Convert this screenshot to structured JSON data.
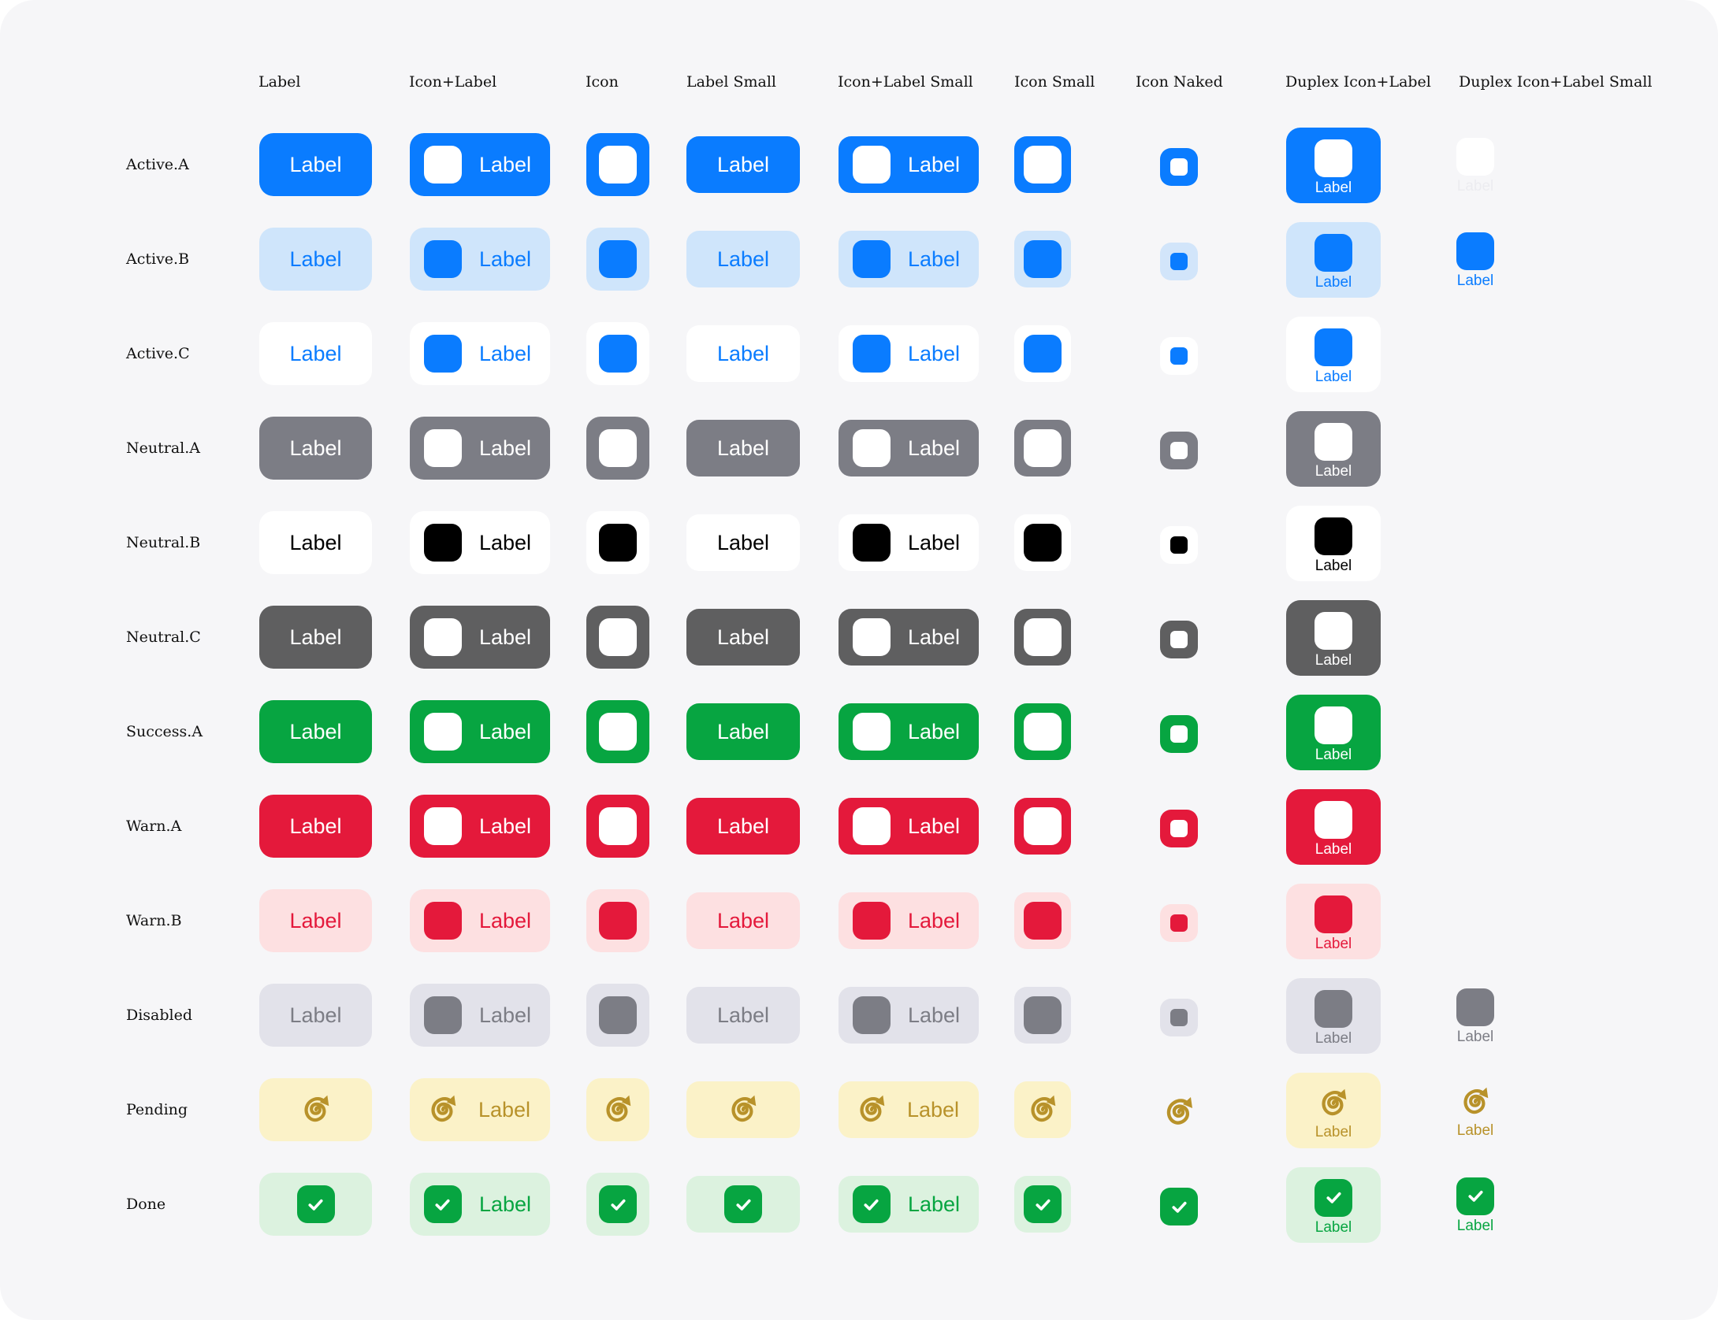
{
  "columns": [
    {
      "key": "label",
      "title": "Label"
    },
    {
      "key": "icon_label",
      "title": "Icon+Label"
    },
    {
      "key": "icon",
      "title": "Icon"
    },
    {
      "key": "label_small",
      "title": "Label Small"
    },
    {
      "key": "icon_label_small",
      "title": "Icon+Label Small"
    },
    {
      "key": "icon_small",
      "title": "Icon Small"
    },
    {
      "key": "icon_naked",
      "title": "Icon Naked"
    },
    {
      "key": "duplex",
      "title": "Duplex Icon+Label"
    },
    {
      "key": "duplex_small",
      "title": "Duplex Icon+Label Small"
    }
  ],
  "button_label": "Label",
  "rows": [
    {
      "name": "Active.A",
      "bg": "#0a7cff",
      "fg": "#ffffff",
      "icon": "#ffffff",
      "ring": "#ffffff",
      "naked_ring": "#0a7cff",
      "naked_bg": "#ffffff",
      "naked_dot": "#ffffff",
      "duplex_small": "ghost"
    },
    {
      "name": "Active.B",
      "bg": "#cfe5fb",
      "fg": "#0a7cff",
      "icon": "#0a7cff",
      "naked_bg": "#d2e5fa",
      "naked_dot": "#0a7cff",
      "duplex_small": "show"
    },
    {
      "name": "Active.C",
      "bg": "#ffffff",
      "fg": "#0a7cff",
      "icon": "#0a7cff",
      "naked_bg": "#ffffff",
      "naked_dot": "#0a7cff",
      "duplex_small": "none"
    },
    {
      "name": "Neutral.A",
      "bg": "#7c7d85",
      "fg": "#ffffff",
      "icon": "#ffffff",
      "ring": "#ffffff",
      "naked_ring": "#7c7d85",
      "naked_bg": "#ffffff",
      "naked_dot": "#ffffff",
      "duplex_small": "none"
    },
    {
      "name": "Neutral.B",
      "bg": "#ffffff",
      "fg": "#000000",
      "icon": "#000000",
      "naked_bg": "#ffffff",
      "naked_dot": "#000000",
      "duplex_small": "none"
    },
    {
      "name": "Neutral.C",
      "bg": "#5f5f60",
      "fg": "#ffffff",
      "icon": "#ffffff",
      "ring": "#ffffff",
      "naked_ring": "#5f5f60",
      "naked_bg": "#ffffff",
      "naked_dot": "#ffffff",
      "duplex_small": "none"
    },
    {
      "name": "Success.A",
      "bg": "#07a541",
      "fg": "#ffffff",
      "icon": "#ffffff",
      "ring": "#ffffff",
      "naked_ring": "#07a541",
      "naked_bg": "#ffffff",
      "naked_dot": "#ffffff",
      "duplex_small": "none"
    },
    {
      "name": "Warn.A",
      "bg": "#e4193b",
      "fg": "#ffffff",
      "icon": "#ffffff",
      "ring": "#ffffff",
      "naked_ring": "#e4193b",
      "naked_bg": "#ffffff",
      "naked_dot": "#ffffff",
      "duplex_small": "none"
    },
    {
      "name": "Warn.B",
      "bg": "#fde0e1",
      "fg": "#e4193b",
      "icon": "#e4193b",
      "naked_bg": "#fde0e1",
      "naked_dot": "#e4193b",
      "duplex_small": "none"
    },
    {
      "name": "Disabled",
      "bg": "#e2e2ea",
      "fg": "#7c7d85",
      "icon": "#7c7d85",
      "naked_bg": "#e2e2ea",
      "naked_dot": "#7c7d85",
      "duplex_small": "show"
    },
    {
      "name": "Pending",
      "bg": "#fbf2c8",
      "fg": "#b8922a",
      "icon": "#b8922a",
      "kind": "pending",
      "duplex_small": "show"
    },
    {
      "name": "Done",
      "bg": "#dcf2df",
      "fg": "#07a541",
      "icon": "#07a541",
      "kind": "done",
      "duplex_small": "show"
    }
  ],
  "icons": {
    "pending": "spiral-arrow-icon",
    "done": "checkmark-icon",
    "default": "rounded-square-icon"
  }
}
